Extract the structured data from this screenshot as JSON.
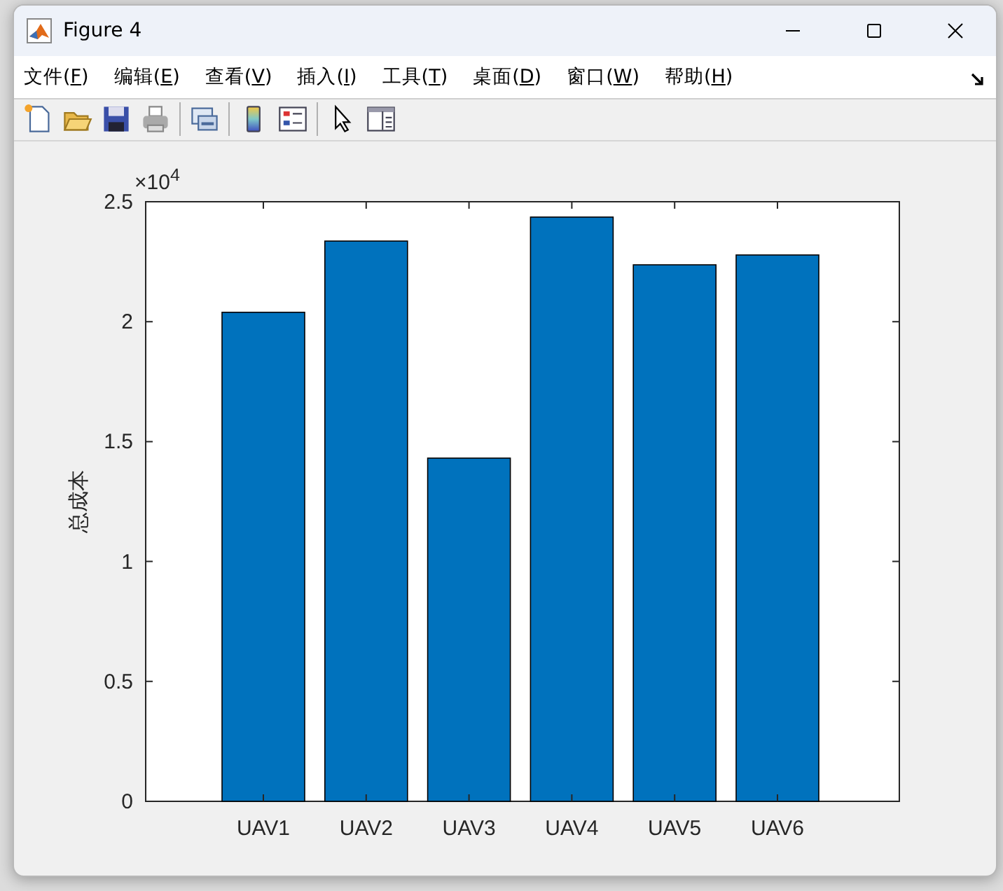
{
  "window": {
    "title": "Figure 4"
  },
  "menu": [
    {
      "before": "文件(",
      "key": "F",
      "after": ")"
    },
    {
      "before": "编辑(",
      "key": "E",
      "after": ")"
    },
    {
      "before": "查看(",
      "key": "V",
      "after": ")"
    },
    {
      "before": "插入(",
      "key": "I",
      "after": ")"
    },
    {
      "before": "工具(",
      "key": "T",
      "after": ")"
    },
    {
      "before": "桌面(",
      "key": "D",
      "after": ")"
    },
    {
      "before": "窗口(",
      "key": "W",
      "after": ")"
    },
    {
      "before": "帮助(",
      "key": "H",
      "after": ")"
    }
  ],
  "toolbar": [
    {
      "kind": "new"
    },
    {
      "kind": "open"
    },
    {
      "kind": "save"
    },
    {
      "kind": "print"
    },
    {
      "kind": "sep"
    },
    {
      "kind": "link"
    },
    {
      "kind": "sep"
    },
    {
      "kind": "colorbar"
    },
    {
      "kind": "legend"
    },
    {
      "kind": "sep"
    },
    {
      "kind": "pointer"
    },
    {
      "kind": "panel"
    }
  ],
  "chart_data": {
    "type": "bar",
    "ylabel": "总成本",
    "categories": [
      "UAV1",
      "UAV2",
      "UAV3",
      "UAV4",
      "UAV5",
      "UAV6"
    ],
    "values": [
      2.039,
      2.336,
      1.431,
      2.436,
      2.237,
      2.278
    ],
    "ylim": [
      0,
      2.5
    ],
    "yticks": [
      0,
      0.5,
      1,
      1.5,
      2,
      2.5
    ],
    "annotations": [
      {
        "text": "×10$^{4}$"
      }
    ]
  }
}
